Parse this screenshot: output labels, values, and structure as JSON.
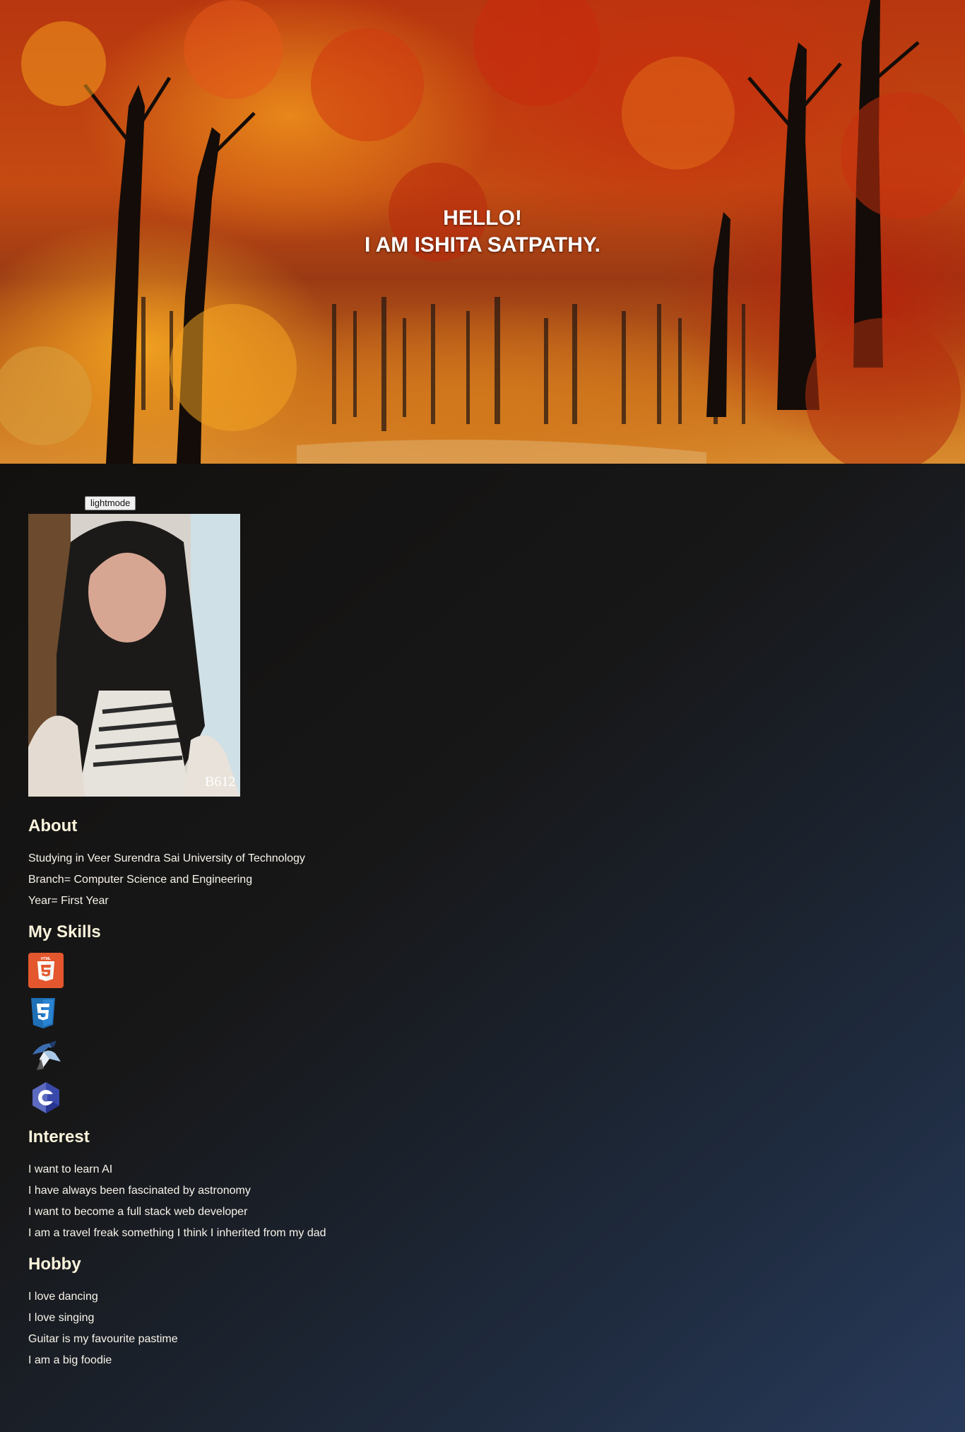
{
  "hero": {
    "line1": "HELLO!",
    "line2": "I AM ISHITA SATPATHY."
  },
  "toggle": {
    "label": "lightmode"
  },
  "profile_photo": {
    "alt": "Profile photo of Ishita Satpathy",
    "watermark": "B612"
  },
  "about": {
    "title": "About",
    "lines": [
      "Studying in Veer Surendra Sai University of Technology",
      "Branch= Computer Science and Engineering",
      "Year= First Year"
    ]
  },
  "skills": {
    "title": "My Skills",
    "icons": [
      "html5-icon",
      "css3-icon",
      "java-icon",
      "c-language-icon"
    ]
  },
  "interest": {
    "title": "Interest",
    "lines": [
      "I want to learn AI",
      "I have always been fascinated by astronomy",
      "I want to become a full stack web developer",
      "I am a travel freak something I think I inherited from my dad"
    ]
  },
  "hobby": {
    "title": "Hobby",
    "lines": [
      "I love dancing",
      "I love singing",
      "Guitar is my favourite pastime",
      "I am a big foodie"
    ]
  },
  "colors": {
    "hero_text": "#ffffff",
    "page_bg_start": "#13110f",
    "page_bg_end": "#283a5b",
    "heading_text": "#fbf3dc",
    "body_text": "#f8f4ea",
    "html5_orange": "#e44d26",
    "css3_blue": "#1f6fb6",
    "c_purple": "#5c6bc0"
  }
}
